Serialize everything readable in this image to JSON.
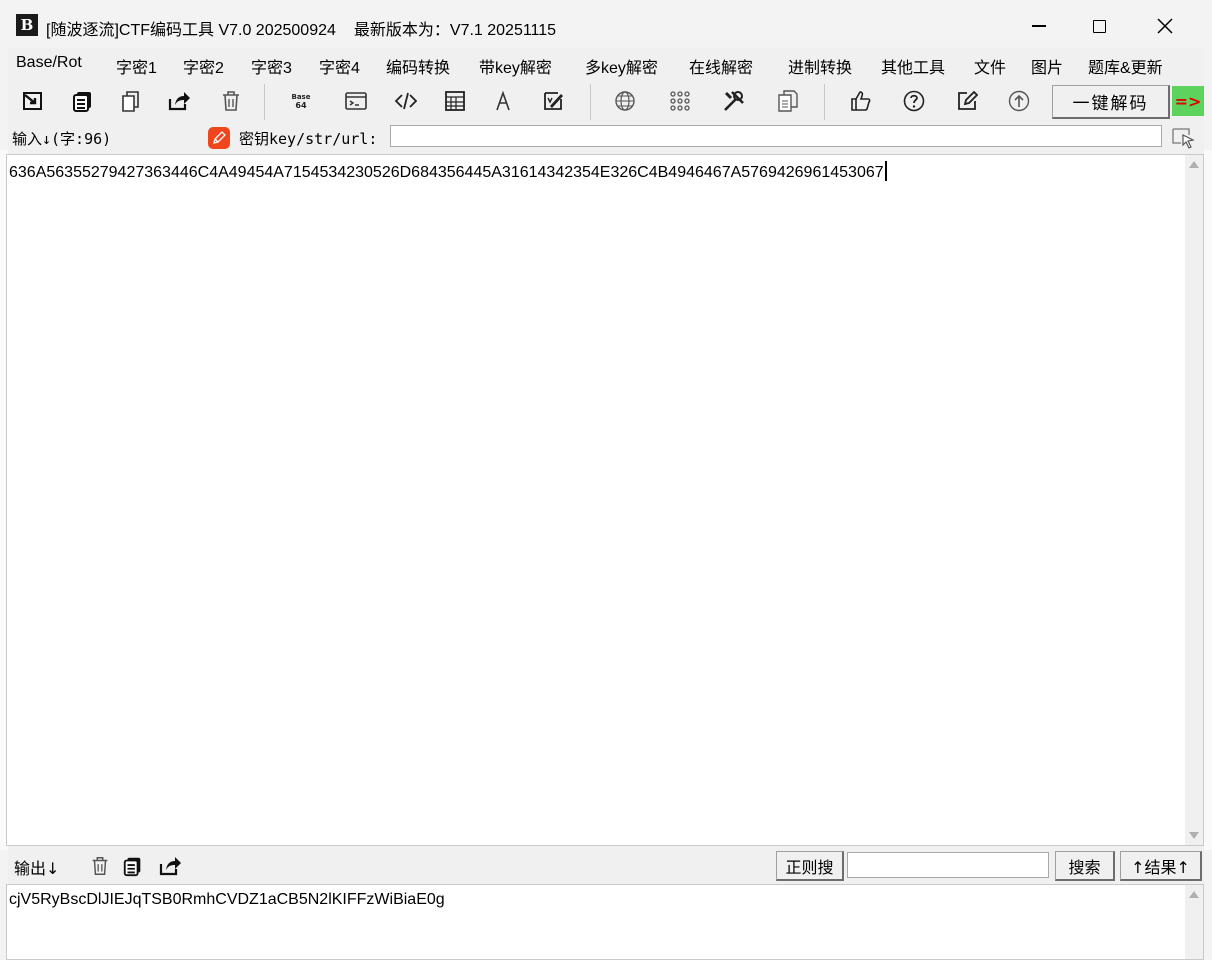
{
  "window": {
    "app_icon_text": "B",
    "title": "[随波逐流]CTF编码工具 V7.0 202500924",
    "latest_version": "最新版本为：V7.1  20251115"
  },
  "menu": [
    "Base/Rot",
    "字密1",
    "字密2",
    "字密3",
    "字密4",
    "编码转换",
    "带key解密",
    "多key解密",
    "在线解密",
    "进制转换",
    "其他工具",
    "文件",
    "图片",
    "题库&更新"
  ],
  "toolbar": {
    "base64_label": "Base 64",
    "decode_button": "一键解码",
    "arrow_badge": "=>"
  },
  "input": {
    "label": "输入↓(字:96)",
    "key_label": "密钥key/str/url:",
    "key_value": "",
    "text": "636A56355279427363446C4A49454A7154534230526D684356445A31614342354E326C4B4946467A5769426961453067"
  },
  "output": {
    "label": "输出↓",
    "regex_button": "正则搜",
    "search_value": "",
    "search_button": "搜索",
    "result_button": "↑结果↑",
    "text": "cjV5RyBscDlJIEJqTSB0RmhCVDZ1aCB5N2lKIFFzWiBiaE0g"
  },
  "colors": {
    "accent_red": "#f0461e",
    "badge_green": "#5dd35d",
    "badge_text": "#e00000"
  }
}
